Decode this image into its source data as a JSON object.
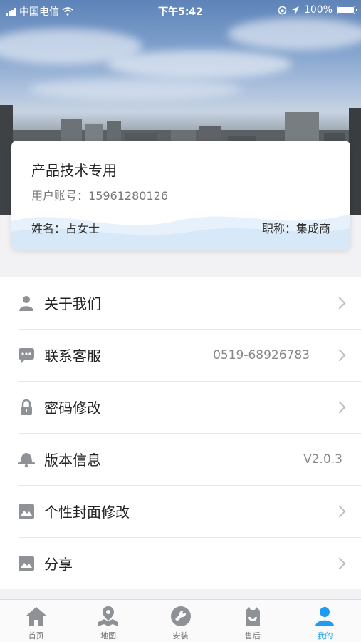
{
  "status_bar": {
    "carrier": "中国电信",
    "time": "下午5:42",
    "battery": "100%"
  },
  "profile": {
    "title": "产品技术专用",
    "account_label": "用户账号：",
    "account": "15961280126",
    "name_label": "姓名：",
    "name": "占女士",
    "role_label": "职称：",
    "role": "集成商"
  },
  "menu": [
    {
      "label": "关于我们",
      "value": "",
      "icon": "person-icon"
    },
    {
      "label": "联系客服",
      "value": "0519-68926783",
      "icon": "chat-icon"
    },
    {
      "label": "密码修改",
      "value": "",
      "icon": "lock-icon"
    },
    {
      "label": "版本信息",
      "value": "V2.0.3",
      "icon": "bell-icon"
    },
    {
      "label": "个性封面修改",
      "value": "",
      "icon": "image-icon"
    },
    {
      "label": "分享",
      "value": "",
      "icon": "image-icon"
    }
  ],
  "tabs": [
    {
      "label": "首页",
      "icon": "home-icon"
    },
    {
      "label": "地图",
      "icon": "map-icon"
    },
    {
      "label": "安装",
      "icon": "wrench-icon"
    },
    {
      "label": "售后",
      "icon": "service-icon"
    },
    {
      "label": "我的",
      "icon": "user-icon",
      "active": true
    }
  ],
  "colors": {
    "accent": "#1e9cf2",
    "icon_gray": "#8e9297"
  }
}
